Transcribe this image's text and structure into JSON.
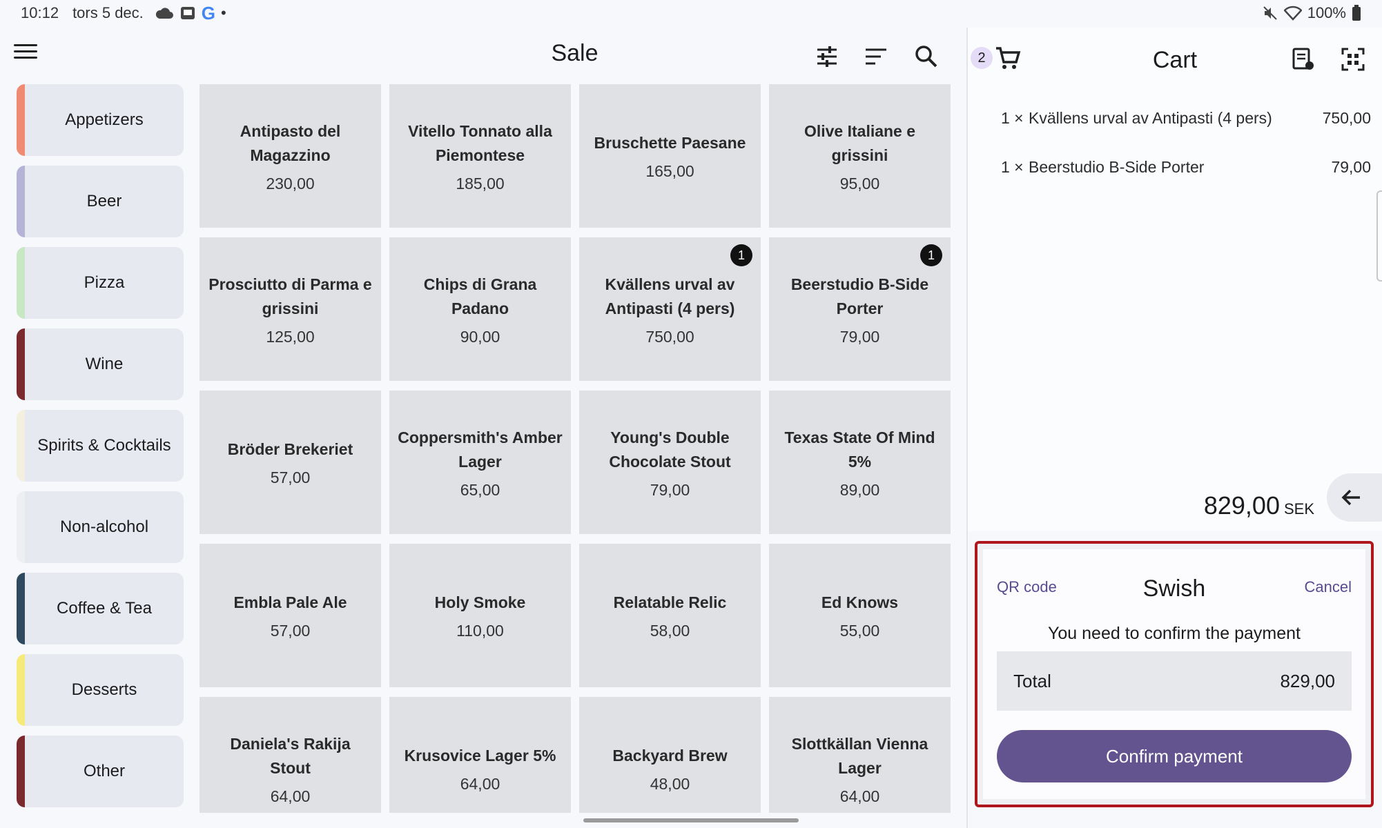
{
  "statusbar": {
    "time": "10:12",
    "date": "tors 5 dec.",
    "battery": "100%"
  },
  "header": {
    "title": "Sale"
  },
  "categories": [
    {
      "label": "Appetizers",
      "color": "#f08a72"
    },
    {
      "label": "Beer",
      "color": "#b5b4d6"
    },
    {
      "label": "Pizza",
      "color": "#c7e8c2"
    },
    {
      "label": "Wine",
      "color": "#7a2a2e"
    },
    {
      "label": "Spirits & Cocktails",
      "color": "#f4f0df"
    },
    {
      "label": "Non-alcohol",
      "color": "#eeeff2"
    },
    {
      "label": "Coffee & Tea",
      "color": "#2f4a5e"
    },
    {
      "label": "Desserts",
      "color": "#f6ea7a"
    },
    {
      "label": "Other",
      "color": "#7a2a2e"
    }
  ],
  "products": [
    {
      "name": "Antipasto del Magazzino",
      "price": "230,00",
      "badge": ""
    },
    {
      "name": "Vitello Tonnato alla Piemontese",
      "price": "185,00",
      "badge": ""
    },
    {
      "name": "Bruschette Paesane",
      "price": "165,00",
      "badge": ""
    },
    {
      "name": "Olive Italiane e grissini",
      "price": "95,00",
      "badge": ""
    },
    {
      "name": "Prosciutto di Parma e grissini",
      "price": "125,00",
      "badge": ""
    },
    {
      "name": "Chips di Grana Padano",
      "price": "90,00",
      "badge": ""
    },
    {
      "name": "Kvällens urval av Antipasti (4 pers)",
      "price": "750,00",
      "badge": "1"
    },
    {
      "name": "Beerstudio B-Side Porter",
      "price": "79,00",
      "badge": "1"
    },
    {
      "name": "Bröder Brekeriet",
      "price": "57,00",
      "badge": ""
    },
    {
      "name": "Coppersmith's Amber Lager",
      "price": "65,00",
      "badge": ""
    },
    {
      "name": "Young's Double Chocolate Stout",
      "price": "79,00",
      "badge": ""
    },
    {
      "name": "Texas State Of Mind 5%",
      "price": "89,00",
      "badge": ""
    },
    {
      "name": "Embla Pale Ale",
      "price": "57,00",
      "badge": ""
    },
    {
      "name": "Holy Smoke",
      "price": "110,00",
      "badge": ""
    },
    {
      "name": "Relatable Relic",
      "price": "58,00",
      "badge": ""
    },
    {
      "name": "Ed Knows",
      "price": "55,00",
      "badge": ""
    },
    {
      "name": "Daniela's Rakija Stout",
      "price": "64,00",
      "badge": ""
    },
    {
      "name": "Krusovice Lager 5%",
      "price": "64,00",
      "badge": ""
    },
    {
      "name": "Backyard Brew",
      "price": "48,00",
      "badge": ""
    },
    {
      "name": "Slottkällan Vienna Lager",
      "price": "64,00",
      "badge": ""
    }
  ],
  "cart": {
    "title": "Cart",
    "count": "2",
    "items": [
      {
        "qty": "1 ×",
        "name": "Kvällens urval av  Antipasti (4 pers)",
        "amount": "750,00"
      },
      {
        "qty": "1 ×",
        "name": "Beerstudio B-Side Porter",
        "amount": "79,00"
      }
    ],
    "total": "829,00",
    "currency": "SEK"
  },
  "swish": {
    "title": "Swish",
    "qr_label": "QR code",
    "cancel_label": "Cancel",
    "message": "You need to confirm the payment",
    "total_label": "Total",
    "total_value": "829,00",
    "confirm_label": "Confirm payment"
  }
}
